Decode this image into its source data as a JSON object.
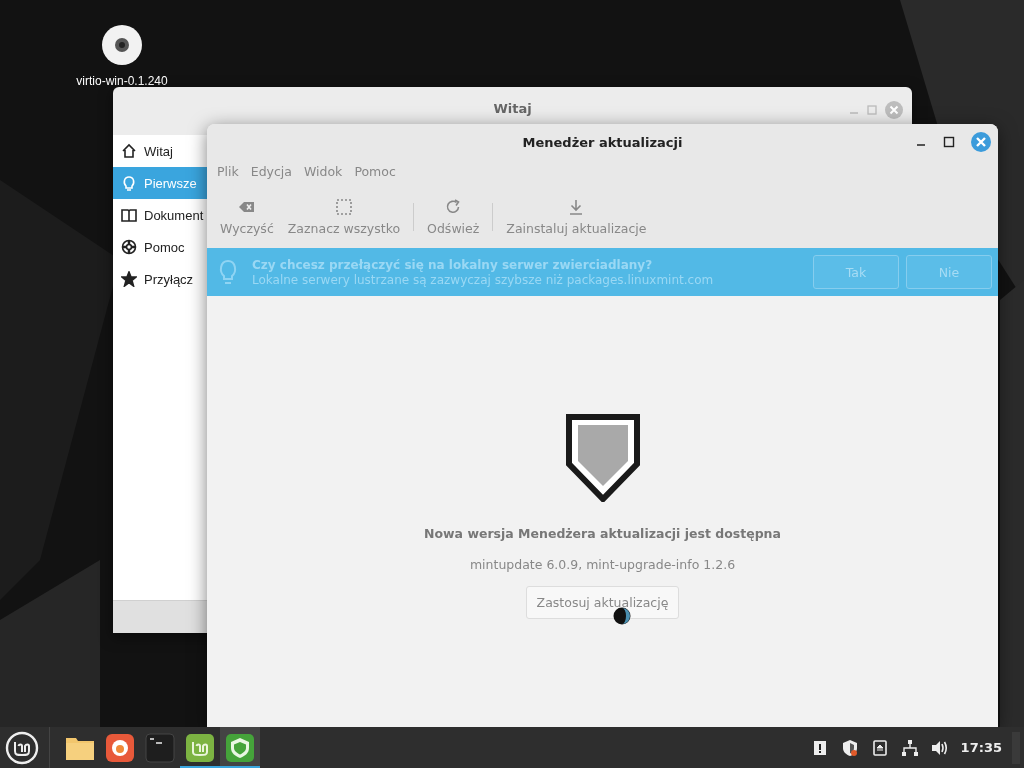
{
  "desktop_icons": [
    {
      "label": "virtio-win-0.1.240",
      "kind": "disc"
    }
  ],
  "back_window": {
    "title": "Witaj",
    "sidebar": [
      {
        "label": "Witaj",
        "kind": "home",
        "selected": false
      },
      {
        "label": "Pierwsze",
        "kind": "bulb",
        "selected": true
      },
      {
        "label": "Dokument",
        "kind": "book",
        "selected": false
      },
      {
        "label": "Pomoc",
        "kind": "lifebuoy",
        "selected": false
      },
      {
        "label": "Przyłącz",
        "kind": "star",
        "selected": false
      }
    ]
  },
  "window": {
    "title": "Menedżer aktualizacji",
    "menu": [
      "Plik",
      "Edycja",
      "Widok",
      "Pomoc"
    ],
    "toolbar": [
      {
        "label": "Wyczyść",
        "kind": "clear",
        "separator_after": false
      },
      {
        "label": "Zaznacz wszystko",
        "kind": "select",
        "separator_after": true
      },
      {
        "label": "Odśwież",
        "kind": "refresh",
        "separator_after": true
      },
      {
        "label": "Zainstaluj aktualizacje",
        "kind": "download",
        "separator_after": false
      }
    ],
    "infobar": {
      "title": "Czy chcesz przełączyć się na lokalny serwer zwierciadlany?",
      "text": "Lokalne serwery lustrzane są zazwyczaj szybsze niż packages.linuxmint.com",
      "buttons": [
        "Tak",
        "Nie"
      ]
    },
    "message": {
      "title": "Nowa wersja Menedżera aktualizacji jest dostępna",
      "detail": "mintupdate 6.0.9, mint-upgrade-info 1.2.6",
      "button": "Zastosuj aktualizację"
    }
  },
  "taskbar": {
    "launchers": [
      {
        "kind": "folder",
        "running": false,
        "active": false
      },
      {
        "kind": "firefox",
        "running": false,
        "active": false
      },
      {
        "kind": "terminal",
        "running": false,
        "active": false
      },
      {
        "kind": "mint",
        "running": true,
        "active": false
      },
      {
        "kind": "shield",
        "running": true,
        "active": true
      }
    ],
    "tray": [
      {
        "kind": "notice"
      },
      {
        "kind": "shield"
      },
      {
        "kind": "eject"
      },
      {
        "kind": "network"
      },
      {
        "kind": "volume"
      }
    ],
    "clock": "17:35"
  }
}
